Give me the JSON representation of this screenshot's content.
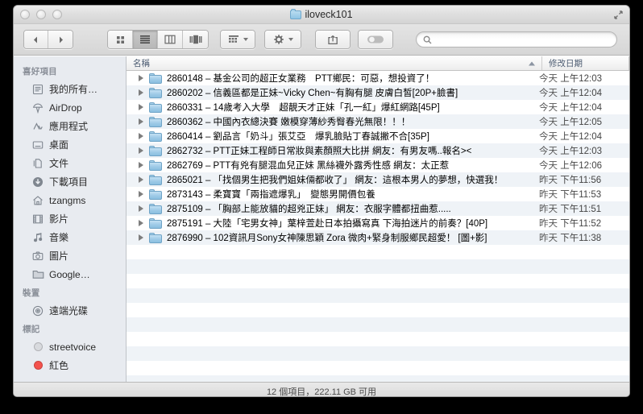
{
  "window": {
    "title": "iloveck101",
    "traffic_lights": [
      "close",
      "minimize",
      "zoom"
    ]
  },
  "toolbar": {
    "back_label": "◀",
    "forward_label": "▶",
    "view_icon_label": "icon-view",
    "view_list_label": "list-view",
    "view_column_label": "column-view",
    "view_coverflow_label": "coverflow-view",
    "arrange_label": "arrange",
    "action_label": "action",
    "share_label": "share",
    "tag_label": "tag",
    "search_placeholder": ""
  },
  "sidebar": {
    "sections": [
      {
        "header": "喜好項目",
        "items": [
          {
            "label": "我的所有…",
            "icon": "all-my-files-icon"
          },
          {
            "label": "AirDrop",
            "icon": "airdrop-icon"
          },
          {
            "label": "應用程式",
            "icon": "applications-icon"
          },
          {
            "label": "桌面",
            "icon": "desktop-icon"
          },
          {
            "label": "文件",
            "icon": "documents-icon"
          },
          {
            "label": "下載項目",
            "icon": "downloads-icon"
          },
          {
            "label": "tzangms",
            "icon": "home-icon"
          },
          {
            "label": "影片",
            "icon": "movies-icon"
          },
          {
            "label": "音樂",
            "icon": "music-icon"
          },
          {
            "label": "圖片",
            "icon": "pictures-icon"
          },
          {
            "label": "Google…",
            "icon": "folder-icon"
          }
        ]
      },
      {
        "header": "裝置",
        "items": [
          {
            "label": "遠端光碟",
            "icon": "remote-disc-icon"
          }
        ]
      },
      {
        "header": "標記",
        "items": [
          {
            "label": "streetvoice",
            "icon": "tag-dot",
            "color": "#d8dade"
          },
          {
            "label": "紅色",
            "icon": "tag-dot",
            "color": "#f4524d"
          }
        ]
      }
    ]
  },
  "columns": {
    "name": "名稱",
    "date_modified": "修改日期",
    "sort_column": "name",
    "sort_direction": "ascending"
  },
  "files": [
    {
      "name": "2860148 – 基金公司的超正女業務　PTT鄉民：可惡，想投資了！",
      "date_day": "今天",
      "date_time": "上午12:03"
    },
    {
      "name": "2860202 – 信義區都是正妹~Vicky Chen~有胸有腿 皮膚白皙[20P+臉書]",
      "date_day": "今天",
      "date_time": "上午12:04"
    },
    {
      "name": "2860331 – 14歲考入大學　超靚天才正妹「孔一紅」爆紅網路[45P]",
      "date_day": "今天",
      "date_time": "上午12:04"
    },
    {
      "name": "2860362 – 中國內衣總決賽 嫩模穿薄紗秀臀春光無限！！！",
      "date_day": "今天",
      "date_time": "上午12:05"
    },
    {
      "name": "2860414 – 劉品言「奶斗」張艾亞　爆乳臉貼丁春誠撇不合[35P]",
      "date_day": "今天",
      "date_time": "上午12:04"
    },
    {
      "name": "2862732 – PTT正妹工程師日常妝與素顏照大比拼 網友：有男友嗎..報名><",
      "date_day": "今天",
      "date_time": "上午12:03"
    },
    {
      "name": "2862769 – PTT有兇有腿混血兒正妹 黑絲襪外露秀性感 網友：太正惹",
      "date_day": "今天",
      "date_time": "上午12:06"
    },
    {
      "name": "2865021 – 「找個男生把我們姐妹倆都收了」 網友：這根本男人的夢想，快選我！",
      "date_day": "昨天",
      "date_time": "下午11:56"
    },
    {
      "name": "2873143 – 柔寶寶「兩指遮爆乳」　變態男開價包養",
      "date_day": "昨天",
      "date_time": "下午11:53"
    },
    {
      "name": "2875109 – 「胸部上能放貓的超兇正妹」 網友：衣服字體都扭曲惹.....",
      "date_day": "昨天",
      "date_time": "下午11:51"
    },
    {
      "name": "2875191 – 大陸「宅男女神」葉梓萱赴日本拍攝寫真 下海拍迷片的前奏？[40P]",
      "date_day": "昨天",
      "date_time": "下午11:52"
    },
    {
      "name": "2876990 – 102資訊月Sony女神陳思穎 Zora  微肉+緊身制服鄉民超愛！ [圖+影]",
      "date_day": "昨天",
      "date_time": "下午11:38"
    }
  ],
  "status": {
    "text": "12 個項目，222.11 GB 可用"
  }
}
